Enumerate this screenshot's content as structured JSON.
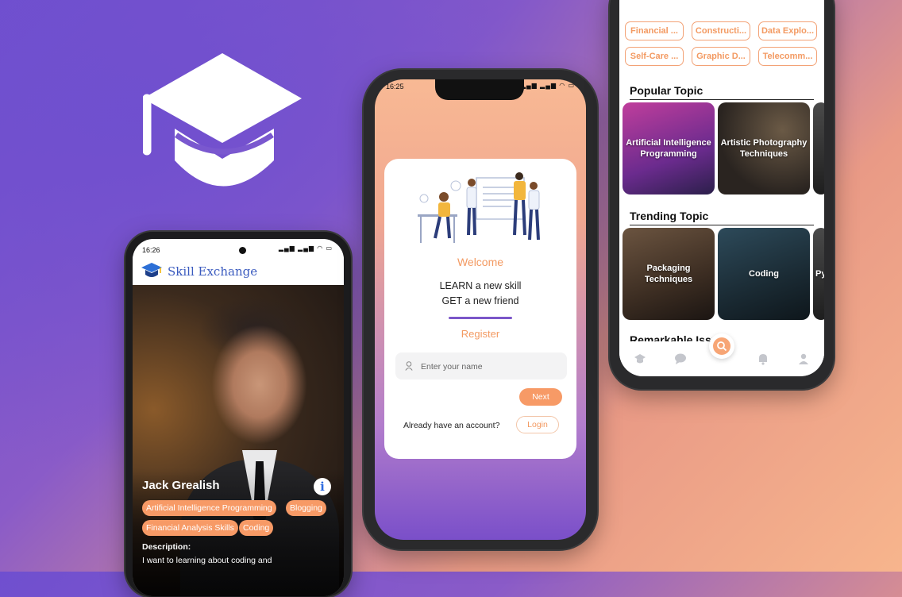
{
  "colors": {
    "accent_orange": "#f79a66",
    "purple": "#7b56c9",
    "title_blue": "#3b5bbf"
  },
  "logo": {
    "icon": "graduation-cap-icon"
  },
  "profile_screen": {
    "status_time": "16:26",
    "app_title": "Skill Exchange",
    "user_name": "Jack Grealish",
    "tags": [
      "Artificial Intelligence Programming",
      "Blogging",
      "Financial Analysis Skills",
      "Coding"
    ],
    "description_label": "Description:",
    "description": "I want to learning about coding and"
  },
  "register_screen": {
    "status_time": "16:25",
    "welcome": "Welcome",
    "tagline_1": "LEARN a new skill",
    "tagline_2": "GET a new friend",
    "register": "Register",
    "name_placeholder": "Enter your name",
    "next_label": "Next",
    "already_text": "Already have an account?",
    "login_label": "Login"
  },
  "explore_screen": {
    "chips": [
      "Financial ...",
      "Constructi...",
      "Data Explo...",
      "Self-Care ...",
      "Graphic D...",
      "Telecomm..."
    ],
    "popular_title": "Popular Topic",
    "popular": [
      "Artificial Intelligence Programming",
      "Artistic Photography Techniques"
    ],
    "trending_title": "Trending Topic",
    "trending": [
      "Packaging Techniques",
      "Coding",
      "Py"
    ],
    "next_section_partial": "Remarkable Issue",
    "nav_icons": [
      "graduation-cap-icon",
      "chat-icon",
      "search-icon",
      "bell-icon",
      "profile-icon"
    ]
  }
}
